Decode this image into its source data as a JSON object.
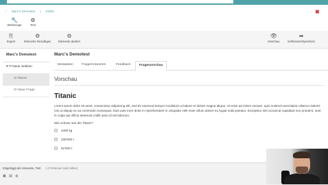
{
  "breadcrumb": {
    "back": "‹",
    "course": "Marc's Demotest",
    "page": "Editor"
  },
  "toolbar_top": [
    {
      "icon": "wrench-icon",
      "glyph": "🔧",
      "label": "Werkzeuge"
    },
    {
      "icon": "gears-icon",
      "glyph": "⚙",
      "label": "Test"
    }
  ],
  "toolbar_actions": [
    {
      "icon": "export-icon",
      "glyph": "⎘",
      "label": "Export"
    },
    {
      "icon": "gear-icon",
      "glyph": "⚙",
      "label": "Elemente hinzufügen"
    },
    {
      "icon": "gear-icon",
      "glyph": "⚙",
      "label": "Elemente ändern"
    },
    {
      "icon": "eye-icon",
      "glyph": "👁",
      "label": "Vorschau"
    },
    {
      "icon": "share-icon",
      "glyph": "➦",
      "label": "Schliessen/Speichern"
    }
  ],
  "sidebar": {
    "title": "Marc's Demotest",
    "items": [
      {
        "label": "Neue Sektion",
        "prefix": "▾ ⚯"
      },
      {
        "label": "Titanic",
        "prefix": "⊙"
      },
      {
        "label": "Neue Frage",
        "prefix": "⊙"
      }
    ]
  },
  "main": {
    "title": "Marc's Demotest",
    "tabs": [
      "Metadaten",
      "Frage/Antworten",
      "Feedback",
      "Fragevorschau"
    ],
    "active_tab": "Fragevorschau",
    "section_title": "Vorschau"
  },
  "question": {
    "title": "Titanic",
    "text": "Lorem ipsum dolor sit amet, consectetur adipiscing elit, sed do eiusmod tempor incididunt ut labore et dolore magna aliqua. Ut enim ad minim veniam, quis nostrud exercitation ullamco laboris nisi ut aliquip ex ea commodo consequat. Duis aute irure dolor in reprehenderit in voluptate velit esse cillum dolore eu fugiat nulla pariatur. Excepteur sint occaecat cupidatat non proident, sunt in culpa qui officia deserunt mollit anim id est laborum.",
    "prompt": "Wie schwer war die Titanic?",
    "options": [
      "4300 kg",
      "230'000 t",
      "52'000 t"
    ]
  },
  "footer": {
    "logged_in": "Eingeloggt als Usename, Test",
    "online": "( 4 Personen sind online)"
  },
  "colors": {
    "accent": "#4fa3a8",
    "close": "#d0312d"
  }
}
